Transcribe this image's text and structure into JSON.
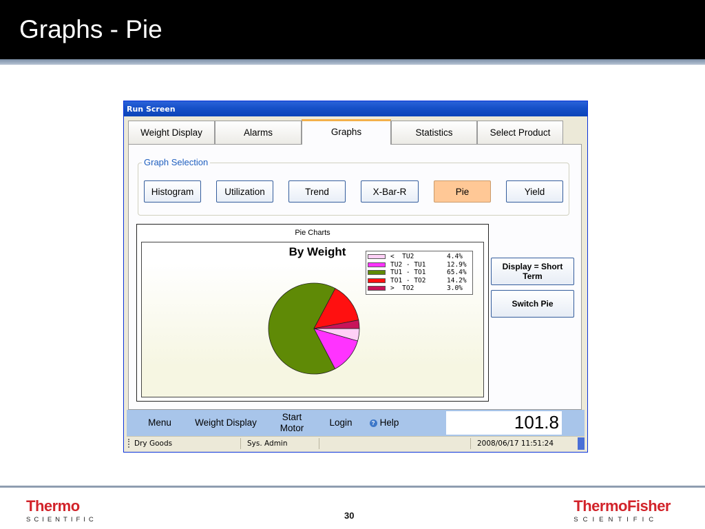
{
  "slide": {
    "title": "Graphs - Pie",
    "page_number": "30",
    "logo_left": {
      "brand": "Thermo",
      "sub": "SCIENTIFIC"
    },
    "logo_right": {
      "brand": "ThermoFisher",
      "sub": "SCIENTIFIC"
    }
  },
  "window": {
    "title": "Run Screen"
  },
  "tabs": [
    {
      "label": "Weight Display",
      "active": false
    },
    {
      "label": "Alarms",
      "active": false
    },
    {
      "label": "Graphs",
      "active": true
    },
    {
      "label": "Statistics",
      "active": false
    },
    {
      "label": "Select Product",
      "active": false
    }
  ],
  "graph_selection": {
    "label": "Graph Selection",
    "buttons": [
      {
        "label": "Histogram",
        "active": false
      },
      {
        "label": "Utilization",
        "active": false
      },
      {
        "label": "Trend",
        "active": false
      },
      {
        "label": "X-Bar-R",
        "active": false
      },
      {
        "label": "Pie",
        "active": true
      },
      {
        "label": "Yield",
        "active": false
      }
    ]
  },
  "side_buttons": {
    "display": "Display =  Short Term",
    "switch_pie": "Switch Pie"
  },
  "chart_data": {
    "type": "pie",
    "frame_title": "Pie Charts",
    "title": "By Weight",
    "slices": [
      {
        "label": "<  TU2",
        "value": 4.4,
        "display": "4.4%",
        "color": "#ffd0f6"
      },
      {
        "label": "TU2 - TU1",
        "value": 12.9,
        "display": "12.9%",
        "color": "#ff33ff"
      },
      {
        "label": "TU1 - TO1",
        "value": 65.4,
        "display": "65.4%",
        "color": "#5f8a06"
      },
      {
        "label": "TO1 - TO2",
        "value": 14.2,
        "display": "14.2%",
        "color": "#ff1010"
      },
      {
        "label": ">  TO2",
        "value": 3.0,
        "display": "3.0%",
        "color": "#c8145a"
      }
    ],
    "legend": "top-right"
  },
  "menubar": {
    "menu": "Menu",
    "weight_display": "Weight Display",
    "start_motor_line1": "Start",
    "start_motor_line2": "Motor",
    "login": "Login",
    "help": "Help",
    "value": "101.8"
  },
  "statusbar": {
    "product": "Dry Goods",
    "user": "Sys. Admin",
    "message": "",
    "datetime": "2008/06/17 11:51:24"
  }
}
